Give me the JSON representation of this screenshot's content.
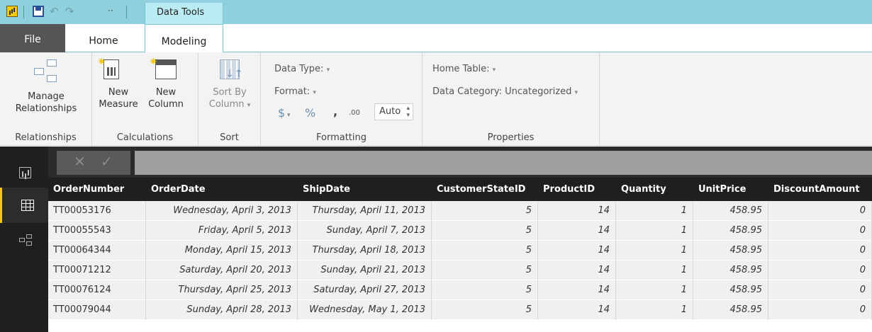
{
  "titlebar": {
    "context_tab": "Data Tools",
    "more_label": "··"
  },
  "tabs": [
    {
      "label": "File"
    },
    {
      "label": "Home"
    },
    {
      "label": "Modeling"
    }
  ],
  "ribbon": {
    "relationships": {
      "button_line1": "Manage",
      "button_line2": "Relationships",
      "group_label": "Relationships"
    },
    "calculations": {
      "measure_line1": "New",
      "measure_line2": "Measure",
      "column_line1": "New",
      "column_line2": "Column",
      "group_label": "Calculations"
    },
    "sort": {
      "line1": "Sort By",
      "line2": "Column",
      "group_label": "Sort"
    },
    "formatting": {
      "data_type": "Data Type:",
      "format": "Format:",
      "currency": "$",
      "percent": "%",
      "comma": ",",
      "decimals": ".00",
      "auto": "Auto",
      "group_label": "Formatting"
    },
    "properties": {
      "home_table": "Home Table:",
      "data_category": "Data Category: Uncategorized",
      "group_label": "Properties"
    }
  },
  "formula_bar": {
    "cancel": "✕",
    "commit": "✓"
  },
  "table": {
    "columns": [
      "OrderNumber",
      "OrderDate",
      "ShipDate",
      "CustomerStateID",
      "ProductID",
      "Quantity",
      "UnitPrice",
      "DiscountAmount"
    ],
    "rows": [
      [
        "TT00053176",
        "Wednesday, April 3, 2013",
        "Thursday, April 11, 2013",
        "5",
        "14",
        "1",
        "458.95",
        "0"
      ],
      [
        "TT00055543",
        "Friday, April 5, 2013",
        "Sunday, April 7, 2013",
        "5",
        "14",
        "1",
        "458.95",
        "0"
      ],
      [
        "TT00064344",
        "Monday, April 15, 2013",
        "Thursday, April 18, 2013",
        "5",
        "14",
        "1",
        "458.95",
        "0"
      ],
      [
        "TT00071212",
        "Saturday, April 20, 2013",
        "Sunday, April 21, 2013",
        "5",
        "14",
        "1",
        "458.95",
        "0"
      ],
      [
        "TT00076124",
        "Thursday, April 25, 2013",
        "Saturday, April 27, 2013",
        "5",
        "14",
        "1",
        "458.95",
        "0"
      ],
      [
        "TT00079044",
        "Sunday, April 28, 2013",
        "Wednesday, May 1, 2013",
        "5",
        "14",
        "1",
        "458.95",
        "0"
      ]
    ]
  },
  "colors": {
    "titlebar": "#8fd0de",
    "accent": "#f2c811",
    "nav_bg": "#1f1f1f"
  }
}
